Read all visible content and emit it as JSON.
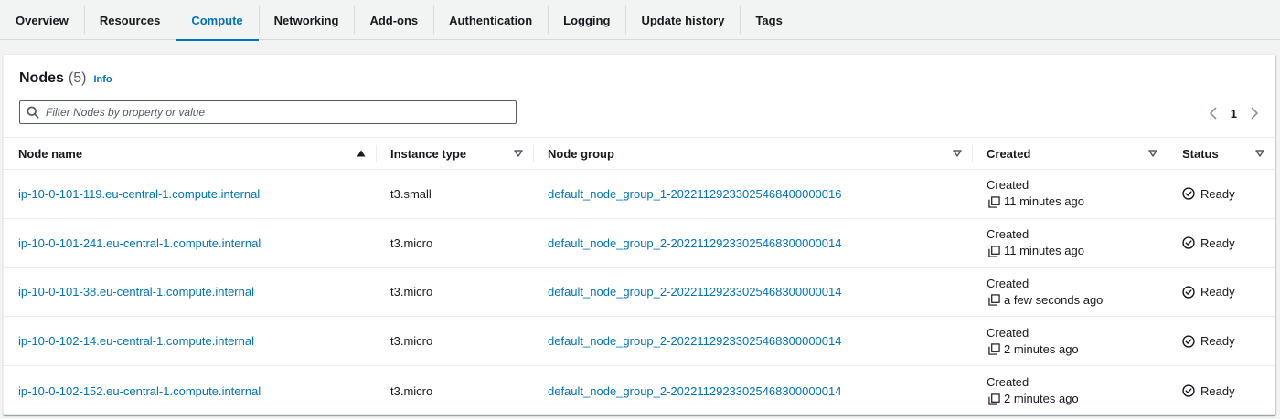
{
  "tabs": [
    {
      "label": "Overview"
    },
    {
      "label": "Resources"
    },
    {
      "label": "Compute",
      "active": true
    },
    {
      "label": "Networking"
    },
    {
      "label": "Add-ons"
    },
    {
      "label": "Authentication"
    },
    {
      "label": "Logging"
    },
    {
      "label": "Update history"
    },
    {
      "label": "Tags"
    }
  ],
  "panel": {
    "title": "Nodes",
    "count": "(5)",
    "info": "Info"
  },
  "filter": {
    "placeholder": "Filter Nodes by property or value",
    "value": ""
  },
  "pagination": {
    "current_page": "1"
  },
  "table": {
    "columns": [
      "Node name",
      "Instance type",
      "Node group",
      "Created",
      "Status"
    ],
    "sort_column": "Node name",
    "sort_direction": "ascending",
    "rows": [
      {
        "node_name": "ip-10-0-101-119.eu-central-1.compute.internal",
        "instance_type": "t3.small",
        "node_group": "default_node_group_1-20221129233025468400000016",
        "created_label": "Created",
        "created_time": "11 minutes ago",
        "status": "Ready"
      },
      {
        "node_name": "ip-10-0-101-241.eu-central-1.compute.internal",
        "instance_type": "t3.micro",
        "node_group": "default_node_group_2-20221129233025468300000014",
        "created_label": "Created",
        "created_time": "11 minutes ago",
        "status": "Ready"
      },
      {
        "node_name": "ip-10-0-101-38.eu-central-1.compute.internal",
        "instance_type": "t3.micro",
        "node_group": "default_node_group_2-20221129233025468300000014",
        "created_label": "Created",
        "created_time": "a few seconds ago",
        "status": "Ready"
      },
      {
        "node_name": "ip-10-0-102-14.eu-central-1.compute.internal",
        "instance_type": "t3.micro",
        "node_group": "default_node_group_2-20221129233025468300000014",
        "created_label": "Created",
        "created_time": "2 minutes ago",
        "status": "Ready"
      },
      {
        "node_name": "ip-10-0-102-152.eu-central-1.compute.internal",
        "instance_type": "t3.micro",
        "node_group": "default_node_group_2-20221129233025468300000014",
        "created_label": "Created",
        "created_time": "2 minutes ago",
        "status": "Ready"
      }
    ]
  },
  "icons": {
    "search": "search-icon",
    "prev": "chevron-left-icon",
    "next": "chevron-right-icon",
    "sort_asc": "caret-up-icon",
    "sort_none": "caret-down-outline-icon",
    "copy": "copy-icon",
    "ready": "check-circle-icon"
  },
  "colors": {
    "link": "#0073bb",
    "text": "#16191f",
    "border": "#eaeded",
    "background": "#f2f3f3"
  }
}
